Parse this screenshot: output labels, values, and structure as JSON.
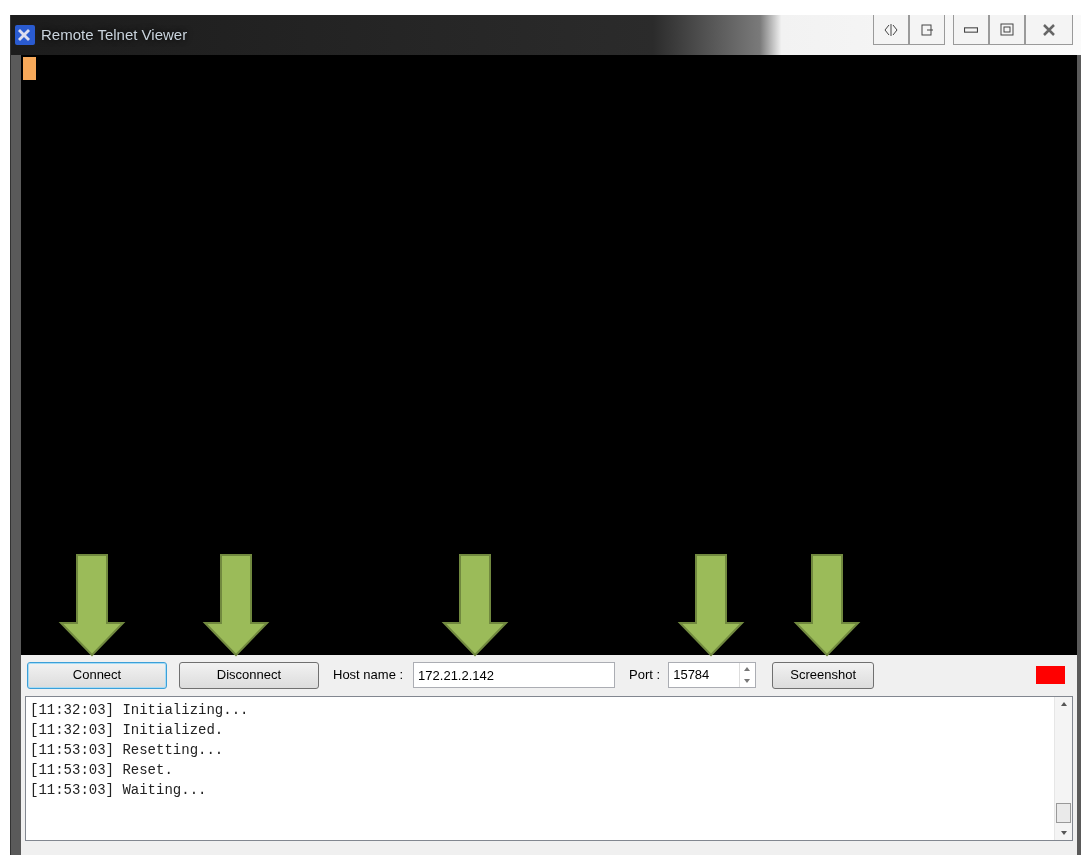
{
  "window": {
    "title": "Remote Telnet Viewer"
  },
  "title_buttons": [
    {
      "kind": "resize"
    },
    {
      "kind": "pin"
    },
    {
      "kind": "minimize"
    },
    {
      "kind": "maximize"
    },
    {
      "kind": "close"
    }
  ],
  "terminal": {
    "cursor": true
  },
  "annotation_arrows": [
    {
      "kind": "down"
    },
    {
      "kind": "down"
    },
    {
      "kind": "down"
    },
    {
      "kind": "down"
    },
    {
      "kind": "down"
    }
  ],
  "toolbar": {
    "connect": {
      "label": "Connect",
      "focused": true
    },
    "disconnect": {
      "label": "Disconnect",
      "focused": false
    },
    "host_label": "Host name :",
    "host_value": "172.21.2.142",
    "port_label": "Port :",
    "port_value": "15784",
    "screenshot": {
      "label": "Screenshot",
      "focused": false
    },
    "status": {
      "color": "#ff0000"
    }
  },
  "log": [
    "[11:32:03] Initializing...",
    "[11:32:03] Initialized.",
    "[11:53:03] Resetting...",
    "[11:53:03] Reset.",
    "[11:53:03] Waiting..."
  ]
}
